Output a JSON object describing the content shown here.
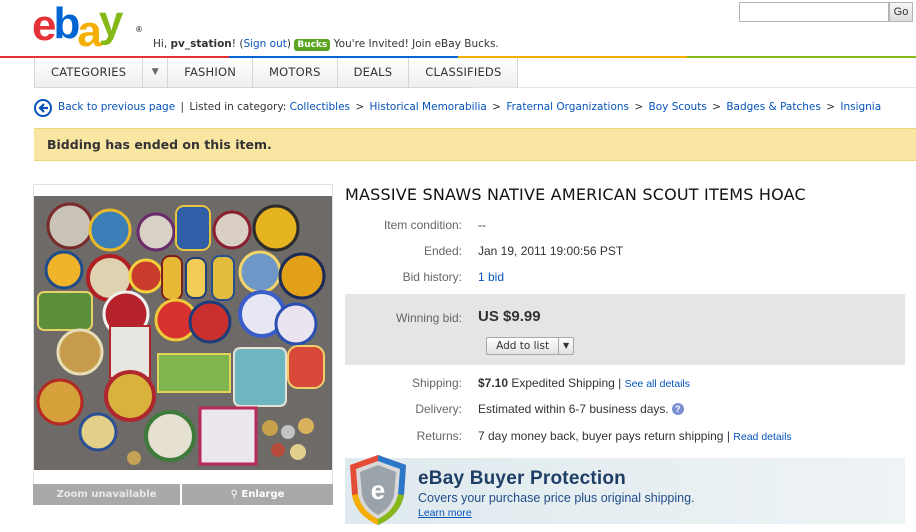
{
  "header": {
    "logo_letters": [
      "e",
      "b",
      "a",
      "y"
    ],
    "logo_reg": "®",
    "greeting_prefix": "Hi, ",
    "username": "pv_station",
    "greeting_suffix": "! (",
    "sign_out": "Sign out",
    "greeting_close": ")",
    "bucks_badge": "Bucks",
    "invite_text": "You're Invited! Join eBay Bucks.",
    "search_placeholder": "",
    "go_label": "Go"
  },
  "nav": {
    "items": [
      "CATEGORIES",
      "FASHION",
      "MOTORS",
      "DEALS",
      "CLASSIFIEDS"
    ]
  },
  "breadcrumb": {
    "back_label": "Back to previous page",
    "divider": "|",
    "listed_in": "Listed in category:",
    "path": [
      "Collectibles",
      "Historical Memorabilia",
      "Fraternal Organizations",
      "Boy Scouts",
      "Badges & Patches",
      "Insignia"
    ],
    "separator": ">"
  },
  "notice": {
    "text": "Bidding has ended on this item."
  },
  "image_panel": {
    "zoom_unavailable": "Zoom unavailable",
    "enlarge": "Enlarge"
  },
  "item": {
    "title": "MASSIVE SNAWS NATIVE AMERICAN SCOUT ITEMS HOAC",
    "condition_label": "Item condition:",
    "condition_value": "--",
    "ended_label": "Ended:",
    "ended_value": "Jan 19, 2011 19:00:56 PST",
    "bid_history_label": "Bid history:",
    "bid_history_value": "1 bid",
    "winning_bid_label": "Winning bid:",
    "winning_bid_value": "US $9.99",
    "add_to_list": "Add to list",
    "shipping_label": "Shipping:",
    "shipping_price": "$7.10",
    "shipping_method": "Expedited Shipping",
    "shipping_divider": "|",
    "shipping_link": "See all details",
    "delivery_label": "Delivery:",
    "delivery_value": "Estimated within 6-7 business days.",
    "returns_label": "Returns:",
    "returns_value": "7 day money back, buyer pays return shipping",
    "returns_divider": "|",
    "returns_link": "Read details"
  },
  "buyer_protection": {
    "title": "eBay Buyer Protection",
    "subtitle": "Covers your purchase price plus original shipping.",
    "learn_more": "Learn more"
  },
  "colors": {
    "link": "#0654ba",
    "notice_bg": "#fae6a3",
    "bid_box_bg": "#e5e5e5"
  }
}
